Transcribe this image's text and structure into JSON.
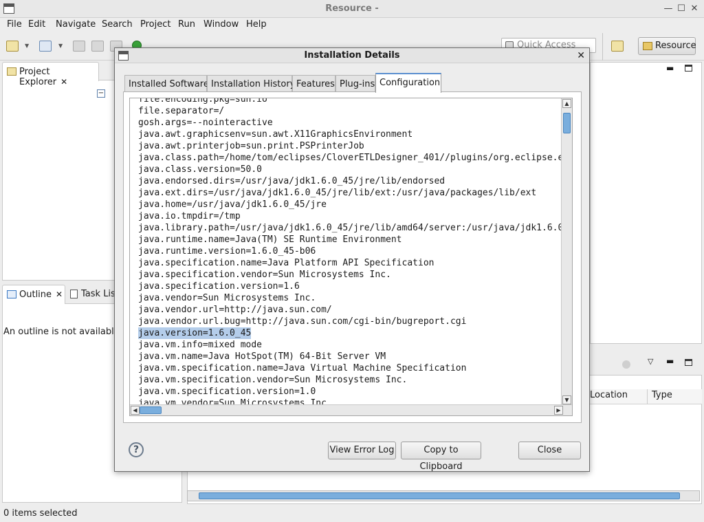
{
  "window": {
    "title": "Resource -"
  },
  "menu": [
    "File",
    "Edit",
    "Navigate",
    "Search",
    "Project",
    "Run",
    "Window",
    "Help"
  ],
  "quick_access": {
    "placeholder": "Quick Access"
  },
  "perspective": {
    "label": "Resource"
  },
  "project_explorer": {
    "tab_label": "Project Explorer"
  },
  "outline": {
    "tab_label": "Outline",
    "task_tab": "Task List",
    "message": "An outline is not available."
  },
  "problems": {
    "columns": [
      "Location",
      "Type"
    ]
  },
  "status": {
    "text": "0 items selected"
  },
  "dialog": {
    "title": "Installation Details",
    "tabs": [
      "Installed Software",
      "Installation History",
      "Features",
      "Plug-ins",
      "Configuration"
    ],
    "active_tab": "Configuration",
    "lines": [
      "file.encoding.pkg=sun.io",
      "file.separator=/",
      "gosh.args=--nointeractive",
      "java.awt.graphicsenv=sun.awt.X11GraphicsEnvironment",
      "java.awt.printerjob=sun.print.PSPrinterJob",
      "java.class.path=/home/tom/eclipses/CloverETLDesigner_401//plugins/org.eclipse.e",
      "java.class.version=50.0",
      "java.endorsed.dirs=/usr/java/jdk1.6.0_45/jre/lib/endorsed",
      "java.ext.dirs=/usr/java/jdk1.6.0_45/jre/lib/ext:/usr/java/packages/lib/ext",
      "java.home=/usr/java/jdk1.6.0_45/jre",
      "java.io.tmpdir=/tmp",
      "java.library.path=/usr/java/jdk1.6.0_45/jre/lib/amd64/server:/usr/java/jdk1.6.0",
      "java.runtime.name=Java(TM) SE Runtime Environment",
      "java.runtime.version=1.6.0_45-b06",
      "java.specification.name=Java Platform API Specification",
      "java.specification.vendor=Sun Microsystems Inc.",
      "java.specification.version=1.6",
      "java.vendor=Sun Microsystems Inc.",
      "java.vendor.url=http://java.sun.com/",
      "java.vendor.url.bug=http://java.sun.com/cgi-bin/bugreport.cgi",
      "java.version=1.6.0_45",
      "java.vm.info=mixed mode",
      "java.vm.name=Java HotSpot(TM) 64-Bit Server VM",
      "java.vm.specification.name=Java Virtual Machine Specification",
      "java.vm.specification.vendor=Sun Microsystems Inc.",
      "java.vm.specification.version=1.0",
      "java.vm.vendor=Sun Microsystems Inc."
    ],
    "selected_line_index": 20,
    "buttons": {
      "view_error_log": "View Error Log",
      "copy_clipboard": "Copy to Clipboard",
      "close": "Close"
    }
  },
  "colors": {
    "accent": "#5b8fd0",
    "selection": "#b4cdea",
    "scroll_thumb": "#7aaedd"
  }
}
